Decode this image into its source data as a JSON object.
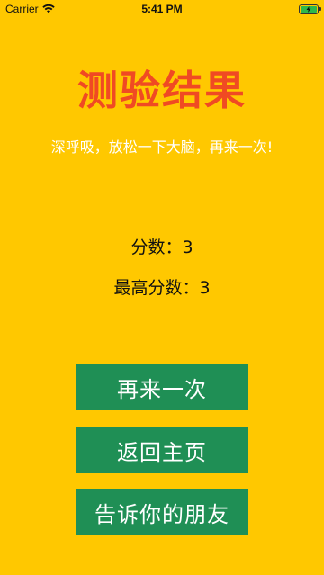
{
  "status_bar": {
    "carrier": "Carrier",
    "time": "5:41 PM",
    "wifi_icon": "wifi-icon",
    "battery_icon": "battery-charging-icon"
  },
  "result": {
    "title": "测验结果",
    "subtitle": "深呼吸，放松一下大脑，再来一次!",
    "score_label": "分数：",
    "score_value": "3",
    "high_score_label": "最高分数：",
    "high_score_value": "3"
  },
  "buttons": {
    "retry": "再来一次",
    "home": "返回主页",
    "share": "告诉你的朋友"
  },
  "colors": {
    "background": "#FFC800",
    "title": "#F04A23",
    "button": "#1F8F55",
    "button_text": "#FFFFFF"
  }
}
